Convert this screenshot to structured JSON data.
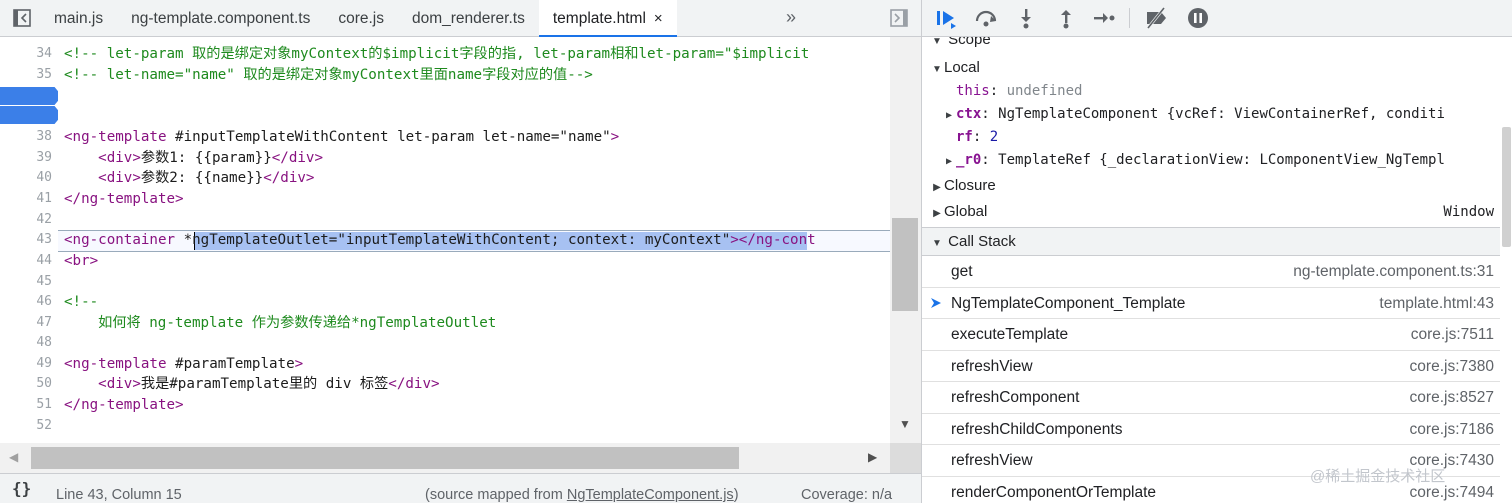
{
  "editor": {
    "tabs": [
      {
        "label": "main.js",
        "active": false
      },
      {
        "label": "ng-template.component.ts",
        "active": false
      },
      {
        "label": "core.js",
        "active": false
      },
      {
        "label": "dom_renderer.ts",
        "active": false
      },
      {
        "label": "template.html",
        "active": true,
        "close": "×"
      }
    ],
    "more_tabs": "»",
    "lines": [
      {
        "n": "34",
        "parts": [
          {
            "c": "c-cm",
            "t": "<!-- let-param 取的是绑定对象myContext的$implicit字段的指, let-param相和let-param=\"$implicit"
          }
        ]
      },
      {
        "n": "35",
        "parts": [
          {
            "c": "c-cm",
            "t": "<!-- let-name=\"name\" 取的是绑定对象myContext里面name字段对应的值-->"
          }
        ]
      },
      {
        "n": "38",
        "parts": [
          {
            "c": "c-tag",
            "t": "<ng-template "
          },
          {
            "c": "c-attr",
            "t": "#inputTemplateWithContent let-param let-name="
          },
          {
            "c": "c-attr",
            "t": "\"name\""
          },
          {
            "c": "c-tag",
            "t": ">"
          }
        ]
      },
      {
        "n": "39",
        "parts": [
          {
            "c": "c-tag",
            "t": "    <div>"
          },
          {
            "c": "c-txt",
            "t": "参数1: {{param}}"
          },
          {
            "c": "c-tag",
            "t": "</div>"
          }
        ]
      },
      {
        "n": "40",
        "parts": [
          {
            "c": "c-tag",
            "t": "    <div>"
          },
          {
            "c": "c-txt",
            "t": "参数2: {{name}}"
          },
          {
            "c": "c-tag",
            "t": "</div>"
          }
        ]
      },
      {
        "n": "41",
        "parts": [
          {
            "c": "c-tag",
            "t": "</ng-template>"
          }
        ]
      },
      {
        "n": "42",
        "parts": []
      },
      {
        "n": "43",
        "parts": [
          {
            "c": "c-tag",
            "t": "<ng-container "
          },
          {
            "c": "c-attr",
            "t": "*ngTemplateOutlet=\"inputTemplateWithContent; context: myContext\""
          },
          {
            "c": "c-tag",
            "t": "></ng-cont"
          }
        ]
      },
      {
        "n": "44",
        "parts": [
          {
            "c": "c-tag",
            "t": "<br>"
          }
        ]
      },
      {
        "n": "45",
        "parts": []
      },
      {
        "n": "46",
        "parts": [
          {
            "c": "c-cm",
            "t": "<!--"
          }
        ]
      },
      {
        "n": "47",
        "parts": [
          {
            "c": "c-cm",
            "t": "    如何将 ng-template 作为参数传递给*ngTemplateOutlet"
          }
        ]
      },
      {
        "n": "48",
        "parts": []
      },
      {
        "n": "49",
        "parts": [
          {
            "c": "c-tag",
            "t": "<ng-template "
          },
          {
            "c": "c-attr",
            "t": "#paramTemplate"
          },
          {
            "c": "c-tag",
            "t": ">"
          }
        ]
      },
      {
        "n": "50",
        "parts": [
          {
            "c": "c-tag",
            "t": "    <div>"
          },
          {
            "c": "c-txt",
            "t": "我是#paramTemplate里的 div 标签"
          },
          {
            "c": "c-tag",
            "t": "</div>"
          }
        ]
      },
      {
        "n": "51",
        "parts": [
          {
            "c": "c-tag",
            "t": "</ng-template>"
          }
        ]
      },
      {
        "n": "52",
        "parts": []
      }
    ],
    "status": {
      "pretty_print": "{}",
      "position": "Line 43, Column 15",
      "source_mapped_prefix": "(source mapped from ",
      "source_mapped_link": "NgTemplateComponent.js",
      "source_mapped_suffix": ")",
      "coverage": "Coverage: n/a"
    }
  },
  "debugger": {
    "toolbar_icons": [
      "resume-icon",
      "step-over-icon",
      "step-into-icon",
      "step-out-icon",
      "step-icon",
      "deactivate-breakpoints-icon",
      "pause-on-exceptions-icon"
    ],
    "scope": {
      "title": "Scope",
      "local_label": "Local",
      "local": {
        "this_key": "this",
        "this_val": "undefined",
        "ctx_key": "ctx",
        "ctx_val": "NgTemplateComponent {vcRef: ViewContainerRef, conditi",
        "rf_key": "rf",
        "rf_val": "2",
        "r0_key": "_r0",
        "r0_val": "TemplateRef {_declarationView: LComponentView_NgTempl"
      },
      "closure_label": "Closure",
      "global_label": "Global",
      "global_val": "Window"
    },
    "callstack": {
      "title": "Call Stack",
      "frames": [
        {
          "fn": "get",
          "loc": "ng-template.component.ts:31",
          "current": false
        },
        {
          "fn": "NgTemplateComponent_Template",
          "loc": "template.html:43",
          "current": true
        },
        {
          "fn": "executeTemplate",
          "loc": "core.js:7511",
          "current": false
        },
        {
          "fn": "refreshView",
          "loc": "core.js:7380",
          "current": false
        },
        {
          "fn": "refreshComponent",
          "loc": "core.js:8527",
          "current": false
        },
        {
          "fn": "refreshChildComponents",
          "loc": "core.js:7186",
          "current": false
        },
        {
          "fn": "refreshView",
          "loc": "core.js:7430",
          "current": false
        },
        {
          "fn": "renderComponentOrTemplate",
          "loc": "core.js:7494",
          "current": false
        }
      ]
    }
  },
  "watermark": "@稀土掘金技术社区",
  "colors": {
    "accent": "#1a73e8",
    "breakpoint": "#3b7fe8",
    "selection": "#a7c1f2"
  }
}
